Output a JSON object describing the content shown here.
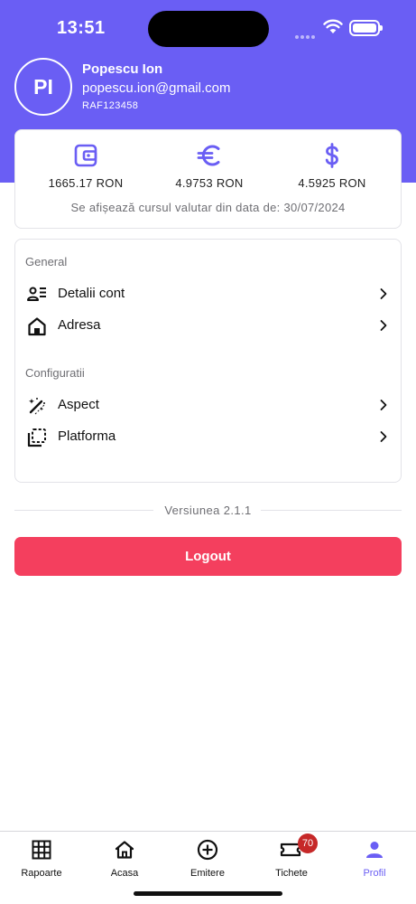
{
  "status_bar": {
    "time": "13:51"
  },
  "profile": {
    "initials": "PI",
    "name": "Popescu Ion",
    "email": "popescu.ion@gmail.com",
    "code": "RAF123458"
  },
  "currency": {
    "items": [
      {
        "icon": "wallet-icon",
        "value": "1665.17 RON"
      },
      {
        "icon": "euro-icon",
        "value": "4.9753 RON"
      },
      {
        "icon": "dollar-icon",
        "value": "4.5925 RON"
      }
    ],
    "note": "Se afișează cursul valutar din data de: 30/07/2024"
  },
  "menu": {
    "general_title": "General",
    "general_items": [
      {
        "icon": "account-details-icon",
        "label": "Detalii cont"
      },
      {
        "icon": "house-icon",
        "label": "Adresa"
      }
    ],
    "config_title": "Configuratii",
    "config_items": [
      {
        "icon": "appearance-icon",
        "label": "Aspect"
      },
      {
        "icon": "platform-icon",
        "label": "Platforma"
      }
    ]
  },
  "version": "Versiunea 2.1.1",
  "logout_label": "Logout",
  "tabs": [
    {
      "icon": "grid-icon",
      "label": "Rapoarte"
    },
    {
      "icon": "home-icon",
      "label": "Acasa"
    },
    {
      "icon": "plus-circle-icon",
      "label": "Emitere"
    },
    {
      "icon": "ticket-icon",
      "label": "Tichete",
      "badge": "70"
    },
    {
      "icon": "person-icon",
      "label": "Profil",
      "active": true
    }
  ],
  "colors": {
    "accent": "#6a5ef4",
    "logout": "#f43f5e",
    "badge": "#c62828"
  }
}
